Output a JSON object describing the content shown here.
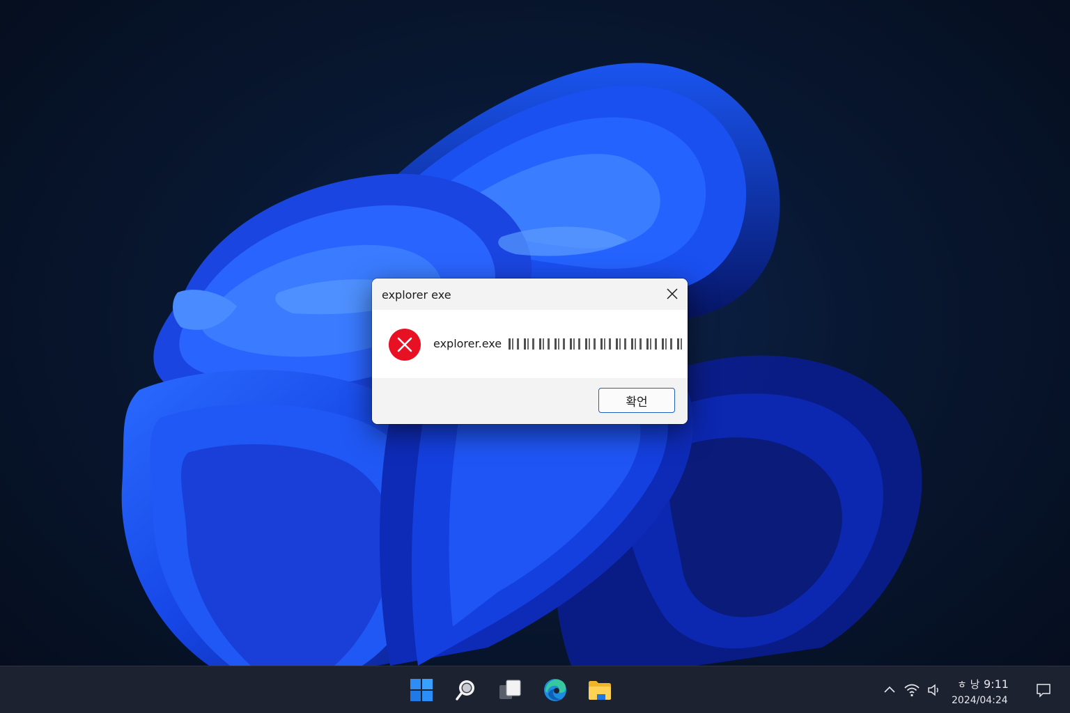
{
  "dialog": {
    "title": "explorer exe",
    "message_prefix": "explorer.exe",
    "ok_label": "확언",
    "error_color": "#e81123"
  },
  "taskbar": {
    "apps": [
      {
        "name": "start",
        "icon": "windows-logo-icon"
      },
      {
        "name": "search",
        "icon": "search-icon"
      },
      {
        "name": "task-view",
        "icon": "task-view-icon"
      },
      {
        "name": "edge",
        "icon": "edge-icon"
      },
      {
        "name": "file-explorer",
        "icon": "folder-icon"
      }
    ],
    "tray": {
      "ime": "ㅎ 낭",
      "time": "9:11",
      "date": "2024/04:24"
    }
  }
}
